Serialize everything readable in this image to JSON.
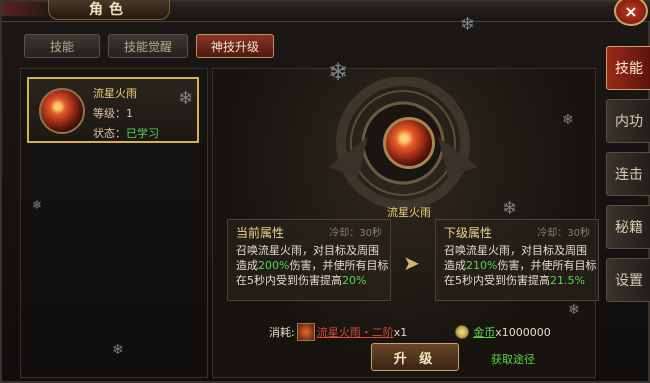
{
  "window": {
    "title": "角色",
    "close_label": "×"
  },
  "top_tabs": [
    {
      "label": "技能",
      "active": false
    },
    {
      "label": "技能觉醒",
      "active": false
    },
    {
      "label": "神技升级",
      "active": true
    }
  ],
  "skill_list": [
    {
      "name": "流星火雨",
      "level_label": "等级：",
      "level": "1",
      "state_label": "状态：",
      "state": "已学习"
    }
  ],
  "detail": {
    "skill_name": "流星火雨",
    "current": {
      "title": "当前属性",
      "cooldown": "冷却：30秒",
      "line1": "召唤流星火雨，对目标及周围",
      "line2_pre": "造成",
      "line2_pct": "200%",
      "line2_post": "伤害，并使所有目标",
      "line3_pre": "在5秒内受到伤害提高",
      "line3_pct": "20%"
    },
    "next": {
      "title": "下级属性",
      "cooldown": "冷却：30秒",
      "line1": "召唤流星火雨，对目标及周围",
      "line2_pre": "造成",
      "line2_pct": "210%",
      "line2_post": "伤害，并使所有目标",
      "line3_pre": "在5秒内受到伤害提高",
      "line3_pct": "21.5%"
    },
    "cost_label": "消耗:",
    "cost_item": "流星火雨・二阶",
    "cost_item_qty": "x1",
    "gold_label": "金币",
    "gold_qty": "x1000000",
    "upgrade_label": "升 级",
    "get_way_label": "获取途径"
  },
  "side_tabs": [
    {
      "label": "技能",
      "active": true
    },
    {
      "label": "内功",
      "active": false
    },
    {
      "label": "连击",
      "active": false
    },
    {
      "label": "秘籍",
      "active": false
    },
    {
      "label": "设置",
      "active": false
    }
  ],
  "colors": {
    "accent_gold": "#d7b24a",
    "positive_green": "#58d64a",
    "active_red": "#9a2a18"
  }
}
